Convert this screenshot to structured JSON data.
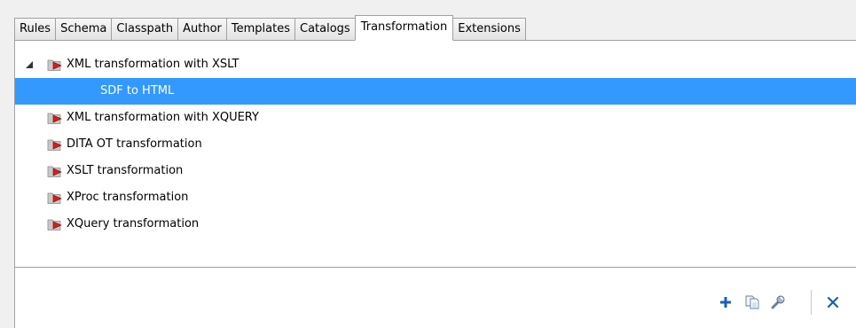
{
  "tabs": [
    {
      "label": "Rules",
      "active": false
    },
    {
      "label": "Schema",
      "active": false
    },
    {
      "label": "Classpath",
      "active": false
    },
    {
      "label": "Author",
      "active": false
    },
    {
      "label": "Templates",
      "active": false
    },
    {
      "label": "Catalogs",
      "active": false
    },
    {
      "label": "Transformation",
      "active": true
    },
    {
      "label": "Extensions",
      "active": false
    }
  ],
  "tree": {
    "items": [
      {
        "label": "XML transformation with XSLT",
        "expanded": true,
        "icon": "folder-scenario-icon"
      },
      {
        "label": "SDF to HTML",
        "selected": true,
        "child": true
      },
      {
        "label": "XML transformation with XQUERY",
        "icon": "folder-scenario-icon"
      },
      {
        "label": "DITA OT transformation",
        "icon": "folder-scenario-icon"
      },
      {
        "label": "XSLT transformation",
        "icon": "folder-scenario-icon"
      },
      {
        "label": "XProc transformation",
        "icon": "folder-scenario-icon"
      },
      {
        "label": "XQuery transformation",
        "icon": "folder-scenario-icon"
      }
    ]
  },
  "toolbar": {
    "icons": [
      "add-icon",
      "copy-icon",
      "edit-icon",
      "remove-icon"
    ]
  },
  "colors": {
    "selection": "#3399ff",
    "folder": "#c9c9c9",
    "arrow": "#cc2222",
    "accent_blue": "#1a5fb4"
  }
}
